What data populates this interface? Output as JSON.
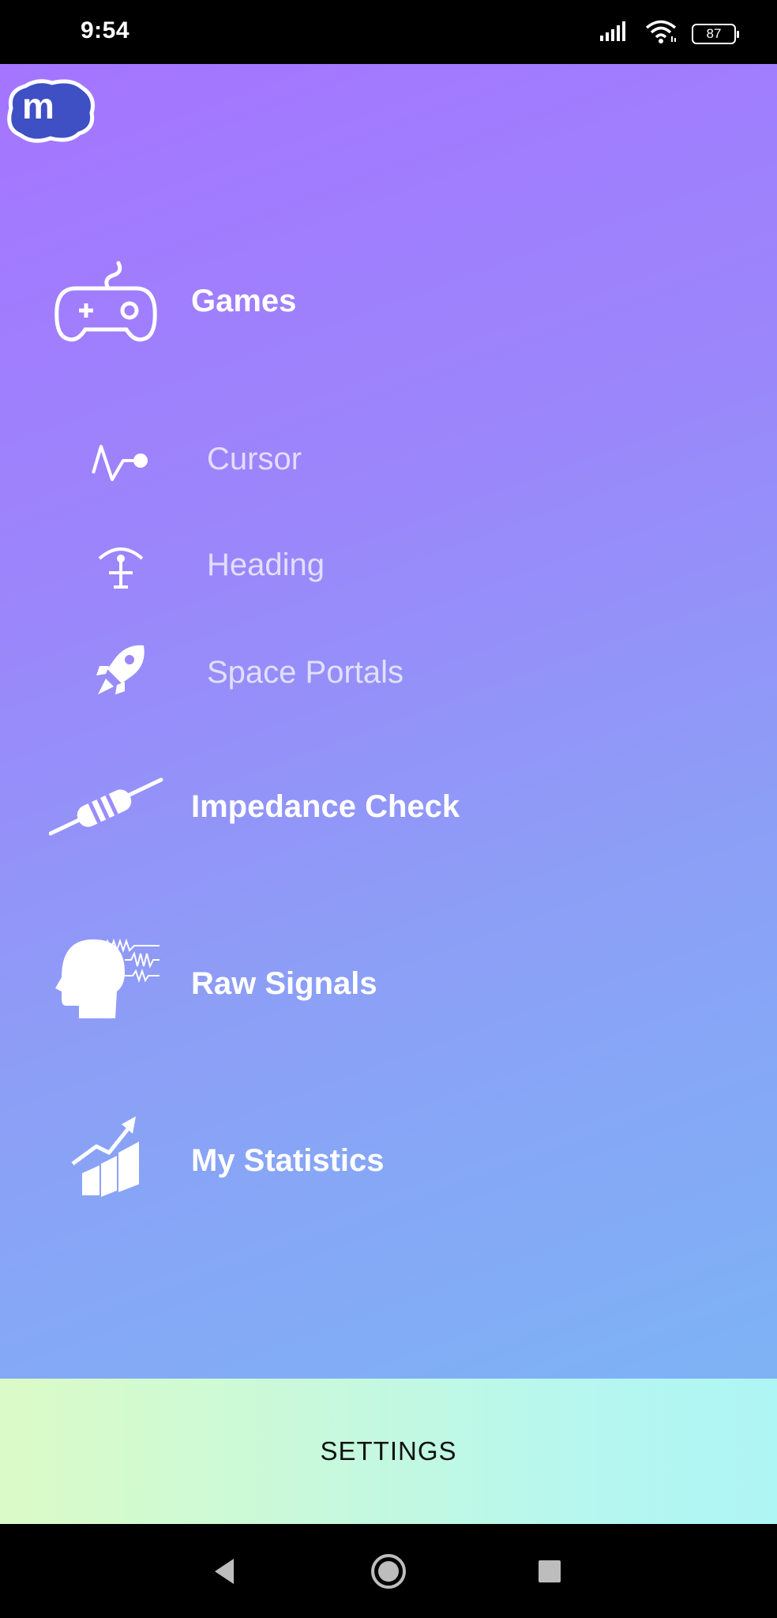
{
  "status_bar": {
    "time": "9:54",
    "battery": "87",
    "signal_icon": "cellular-signal-icon",
    "wifi_icon": "wifi-icon"
  },
  "app": {
    "logo_letter": "m",
    "logo_color": "#3f4fc4"
  },
  "menu": {
    "games": {
      "label": "Games",
      "icon": "gamepad-icon"
    },
    "cursor": {
      "label": "Cursor",
      "icon": "cursor-signal-icon"
    },
    "heading": {
      "label": "Heading",
      "icon": "heading-icon"
    },
    "space_portals": {
      "label": "Space Portals",
      "icon": "rocket-icon"
    },
    "impedance_check": {
      "label": "Impedance Check",
      "icon": "resistor-icon"
    },
    "raw_signals": {
      "label": "Raw Signals",
      "icon": "head-waves-icon"
    },
    "my_statistics": {
      "label": "My Statistics",
      "icon": "growth-chart-icon"
    }
  },
  "settings": {
    "label": "SETTINGS"
  },
  "nav": {
    "back_icon": "back-triangle-icon",
    "home_icon": "home-circle-icon",
    "recents_icon": "recents-square-icon"
  }
}
